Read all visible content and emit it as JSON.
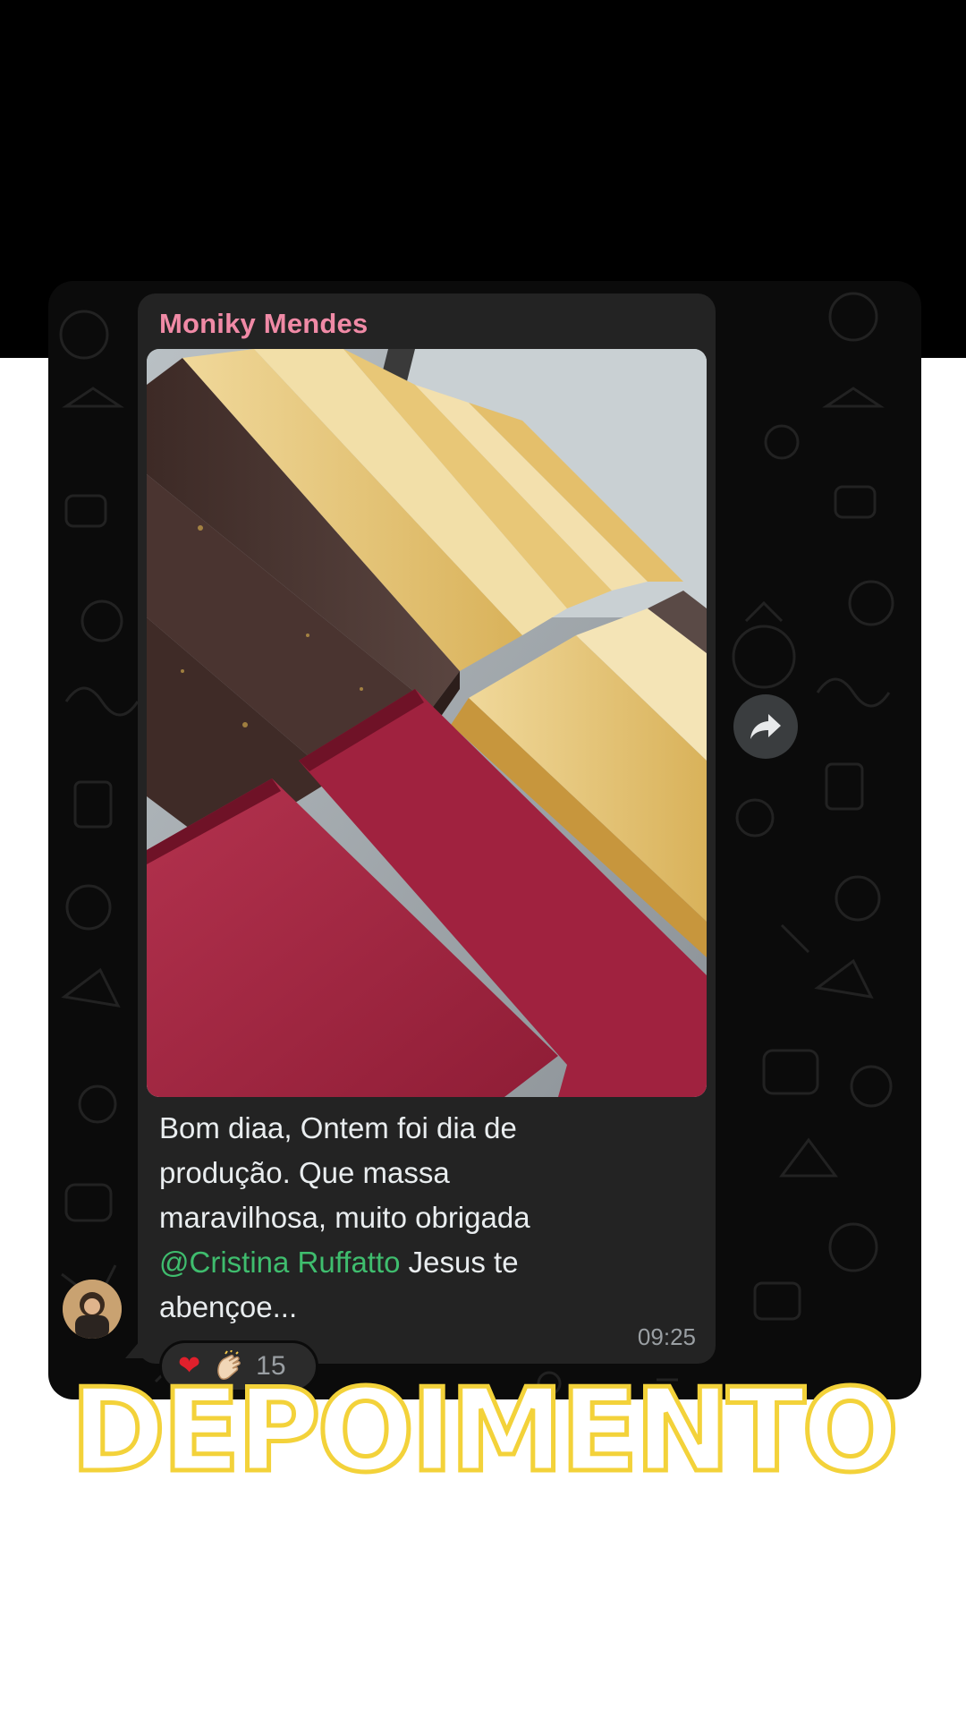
{
  "chat": {
    "sender_name": "Moniky Mendes",
    "message_text": "Bom diaa, Ontem foi dia de produção. Que massa maravilhosa, muito obrigada",
    "mention": "@Cristina Ruffatto",
    "message_tail": " Jesus te abençoe...",
    "timestamp": "09:25",
    "reactions": {
      "emojis": [
        "red-heart",
        "clapping-hands"
      ],
      "count": "15"
    },
    "icons": {
      "forward": "forward-arrow-icon",
      "avatar": "sender-avatar"
    },
    "colors": {
      "sender_name": "#f08aa6",
      "mention": "#3fbd6e",
      "bubble": "#232323"
    }
  },
  "caption": {
    "title": "DEPOIMENTO",
    "outline_color": "#f3d23a"
  }
}
